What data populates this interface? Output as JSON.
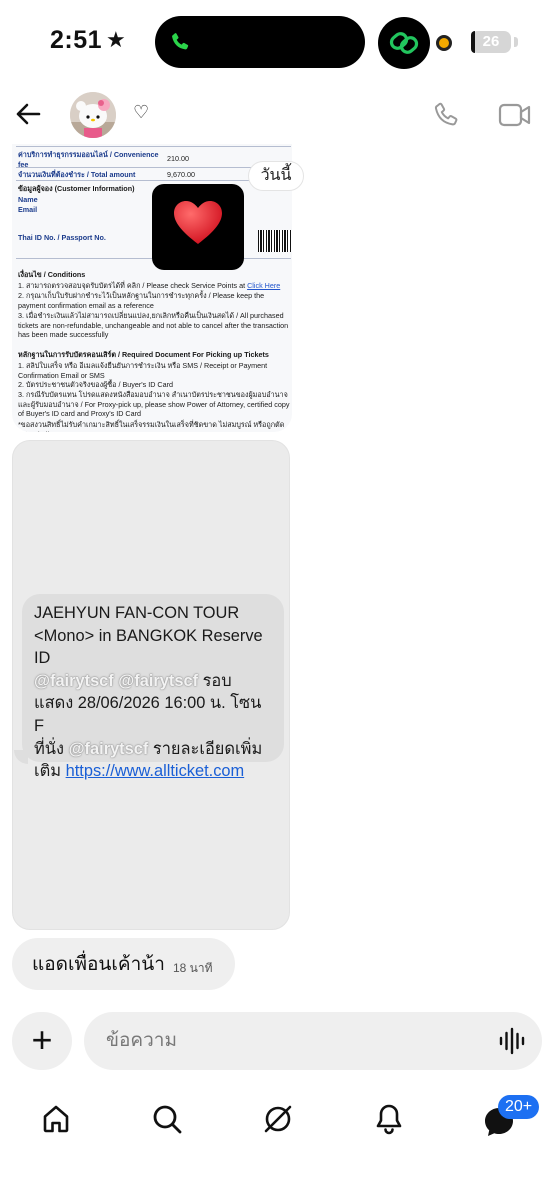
{
  "status_bar": {
    "time": "2:51",
    "battery": "26"
  },
  "header": {
    "name_suffix": "♡"
  },
  "ticket": {
    "fee_label": "ค่าบริการทำธุรกรรมออนไลน์ / Convenience fee",
    "fee_value": "210.00",
    "total_label": "จำนวนเงินที่ต้องชำระ / Total amount",
    "total_value": "9,670.00",
    "customer_heading": "ข้อมูลผู้จอง (Customer Information)",
    "name_label": "Name",
    "email_label": "Email",
    "id_label": "Thai ID No. / Passport No.",
    "conditions_heading": "เงื่อนไข / Conditions",
    "condition_1": "1. สามารถตรวจสอบจุดรับบัตรได้ที่ คลิก / Please check Service Points at",
    "condition_1_link": "Click Here",
    "condition_2": "2. กรุณาเก็บใบรับฝากชำระไว้เป็นหลักฐานในการชำระทุกครั้ง / Please keep the payment confirmation email as a reference",
    "condition_3": "3. เมื่อชำระเงินแล้วไม่สามารถเปลี่ยนแปลง,ยกเลิกหรือคืนเป็นเงินสดได้ / All purchased tickets are non-refundable, unchangeable and not able to cancel after the transaction has been made successfully",
    "required_heading": "หลักฐานในการรับบัตรคอนเสิร์ต / Required Document For Picking up Tickets",
    "required_1": "1. สลิปใบเสร็จ หรือ อีเมลแจ้งยืนยันการชำระเงิน หรือ SMS / Receipt or Payment Confirmation Email or SMS",
    "required_2": "2. บัตรประชาชนตัวจริงของผู้ซื้อ / Buyer's ID Card",
    "required_3": "3. กรณีรับบัตรแทน โปรดแสดงหนังสือมอบอำนาจ สำเนาบัตรประชาชนของผู้มอบอำนาจและผู้รับมอบอำนาจ / For Proxy-pick up, please show Power of Attorney, certified copy of Buyer's ID card and Proxy's ID Card",
    "footnote": "*ขอสงวนสิทธิ์ไม่รับคำเกมาะสิทธิ์ในเสร็จรรมเงินในเสร็จที่ชิดขาด ไม่สมบูรณ์ หรือถูกตัดแปลง / All"
  },
  "today_label": "วันนี้",
  "sms": {
    "line1": "JAEHYUN FAN-CON TOUR",
    "line2": "<Mono> in BANGKOK Reserve ID",
    "line3_watermark": "@fairytscf @fairytscf",
    "line3_tail": "รอบ",
    "line4": "แสดง 28/06/2026 16:00 น. โซน F",
    "line5_start": "ที่นั่ง",
    "line5_watermark": "@fairytscf",
    "line5_end": "รายละเอียดเพิ่ม",
    "line6_start": "เติม",
    "link": "https://www.allticket.com"
  },
  "last_message": {
    "text": "แอดเพื่อนเค้าน้า",
    "time": "18 นาที"
  },
  "composer": {
    "placeholder": "ข้อความ"
  },
  "nav": {
    "messages_badge": "20+"
  },
  "colors": {
    "accent_blue": "#1d70f2",
    "bubble_gray": "#efefef",
    "heart_red": "#e0202e"
  }
}
